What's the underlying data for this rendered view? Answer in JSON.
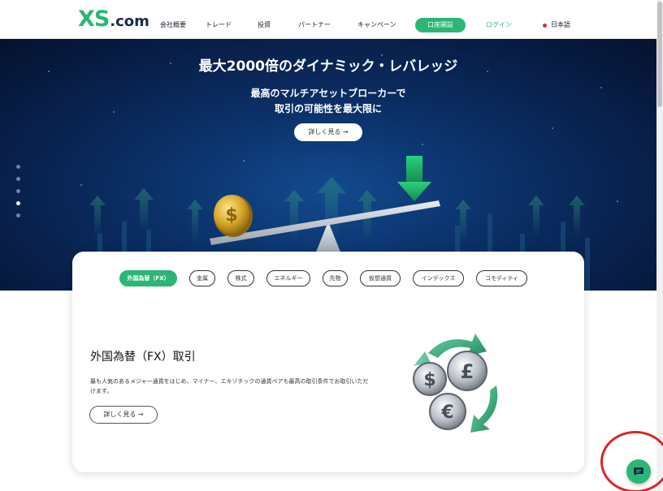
{
  "header": {
    "logo": {
      "main": "XS",
      "suffix": ".com"
    },
    "nav": [
      {
        "label": "会社概要"
      },
      {
        "label": "トレード"
      },
      {
        "label": "投資"
      },
      {
        "label": "パートナー"
      },
      {
        "label": "キャンペーン"
      }
    ],
    "open_account": "口座開設",
    "login": "ログイン",
    "language": "日本語"
  },
  "hero": {
    "title": "最大2000倍のダイナミック・レバレッジ",
    "subtitle_line1": "最高のマルチアセットブローカーで",
    "subtitle_line2": "取引の可能性を最大限に",
    "button": "詳しく見る →",
    "slides": 5,
    "active_slide": 4
  },
  "products": {
    "tabs": [
      {
        "label": "外国為替（FX）",
        "active": true
      },
      {
        "label": "金属",
        "active": false
      },
      {
        "label": "株式",
        "active": false
      },
      {
        "label": "エネルギー",
        "active": false
      },
      {
        "label": "先物",
        "active": false
      },
      {
        "label": "仮想通貨",
        "active": false
      },
      {
        "label": "インデックス",
        "active": false
      },
      {
        "label": "コモディティ",
        "active": false
      }
    ],
    "title": "外国為替（FX）取引",
    "description": "最も人気のあるメジャー通貨をはじめ、マイナー、エキゾチックの通貨ペアも最高の取引条件でお取引いただけます。",
    "button": "詳しく見る →"
  },
  "colors": {
    "brand_green": "#2bb673",
    "navy": "#1a2b4c",
    "hero_bg": "#0b2f66",
    "highlight_circle": "#d92626"
  },
  "icons": [
    "dollar-coin-icon",
    "seesaw-icon",
    "down-arrow-icon",
    "currency-coins-icon",
    "chat-icon"
  ]
}
